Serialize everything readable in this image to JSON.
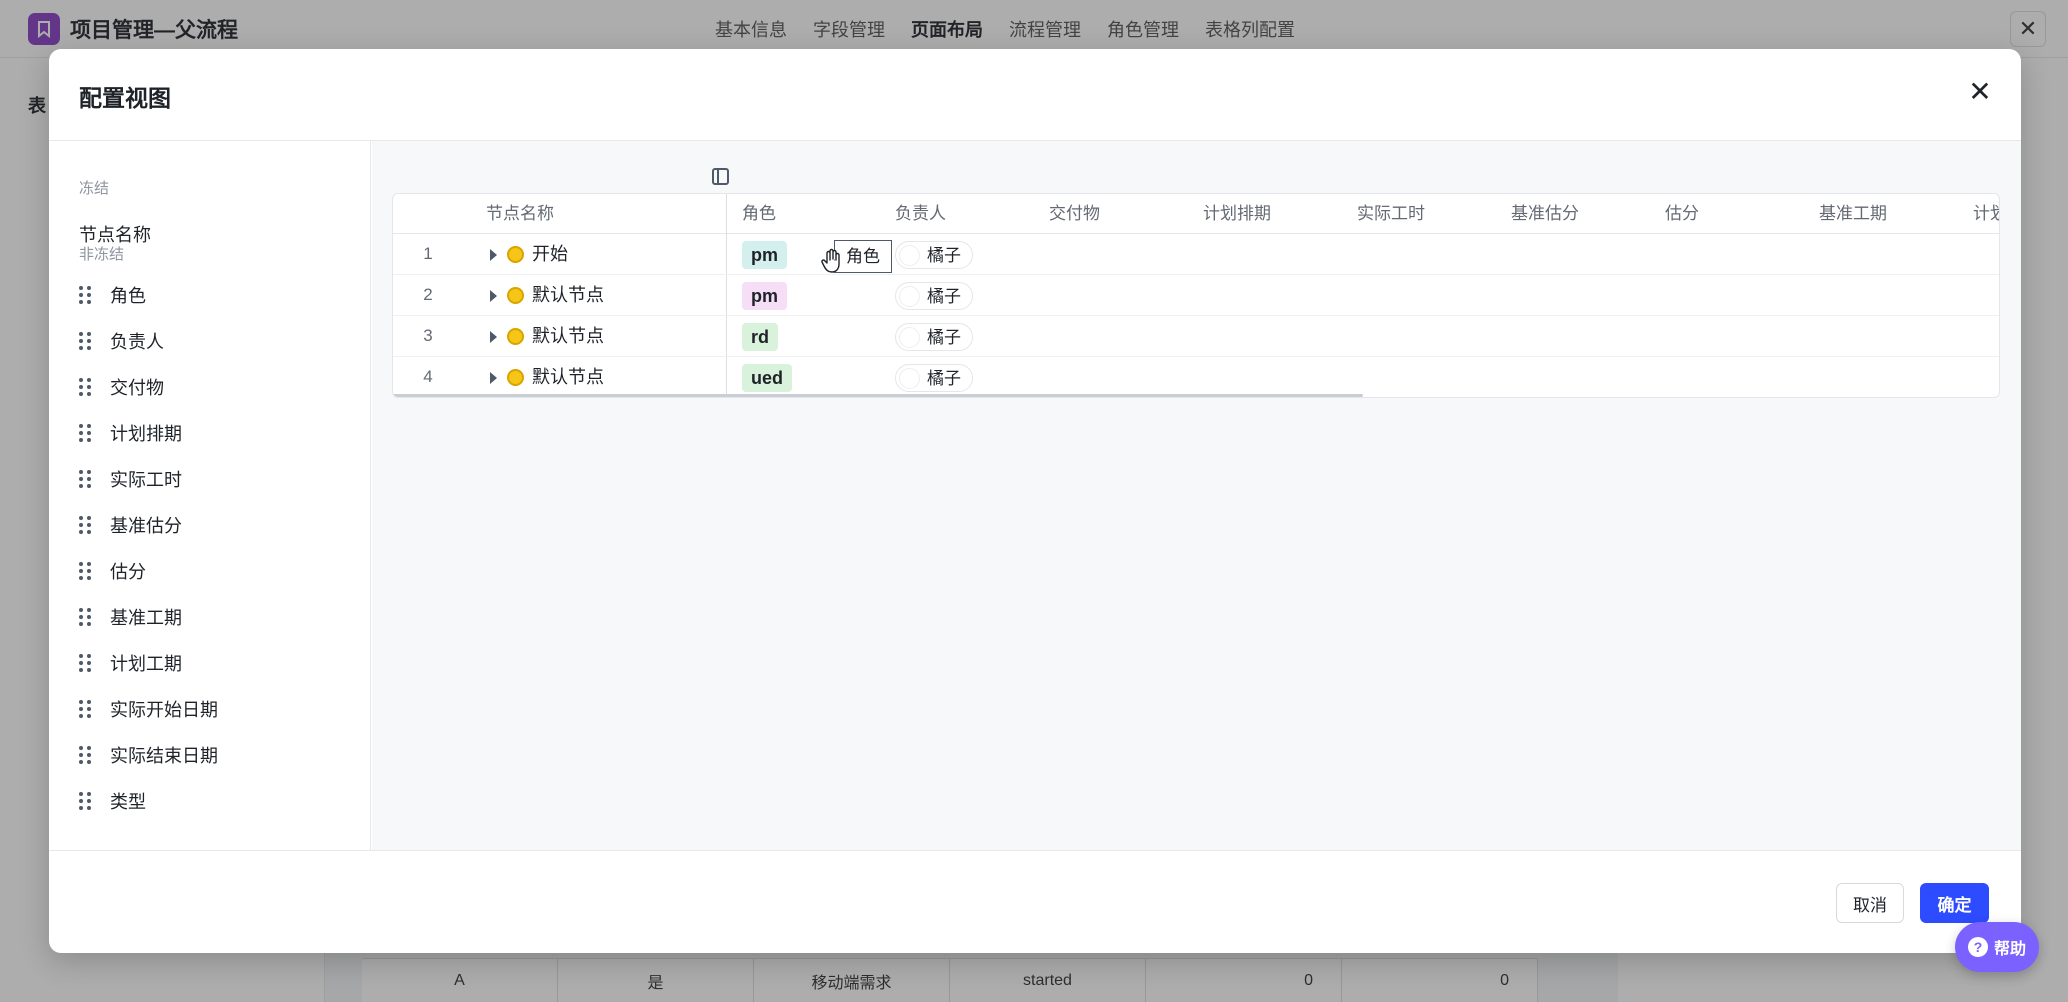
{
  "app": {
    "title": "项目管理—父流程",
    "nav": [
      "基本信息",
      "字段管理",
      "页面布局",
      "流程管理",
      "角色管理",
      "表格列配置"
    ],
    "active_nav": "页面布局",
    "close_icon": "close-icon",
    "left_label_partial": "表"
  },
  "background_table_row": [
    "A",
    "是",
    "移动端需求",
    "started",
    "0",
    "0"
  ],
  "modal": {
    "title": "配置视图",
    "frozen_section_label": "冻结",
    "frozen_items": [
      "节点名称"
    ],
    "unfrozen_section_label": "非冻结",
    "unfrozen_items": [
      "角色",
      "负责人",
      "交付物",
      "计划排期",
      "实际工时",
      "基准估分",
      "估分",
      "基准工期",
      "计划工期",
      "实际开始日期",
      "实际结束日期",
      "类型"
    ],
    "cancel_label": "取消",
    "confirm_label": "确定"
  },
  "grid": {
    "headers": [
      "节点名称",
      "角色",
      "负责人",
      "交付物",
      "计划排期",
      "实际工时",
      "基准估分",
      "估分",
      "基准工期",
      "计划"
    ],
    "rows": [
      {
        "num": "1",
        "name": "开始",
        "role": "pm",
        "role_color": "#d4f0ee",
        "owner": "橘子"
      },
      {
        "num": "2",
        "name": "默认节点",
        "role": "pm",
        "role_color": "#f6def7",
        "owner": "橘子"
      },
      {
        "num": "3",
        "name": "默认节点",
        "role": "rd",
        "role_color": "#d9f2dc",
        "owner": "橘子"
      },
      {
        "num": "4",
        "name": "默认节点",
        "role": "ued",
        "role_color": "#d9f2dc",
        "owner": "橘子"
      }
    ],
    "drag_ghost_label": "角色",
    "status_color": "#f5c518"
  },
  "help": {
    "label": "帮助"
  },
  "colors": {
    "primary": "#2d4bff",
    "help": "#7b61ff",
    "app_logo": "#8a3fc7"
  }
}
